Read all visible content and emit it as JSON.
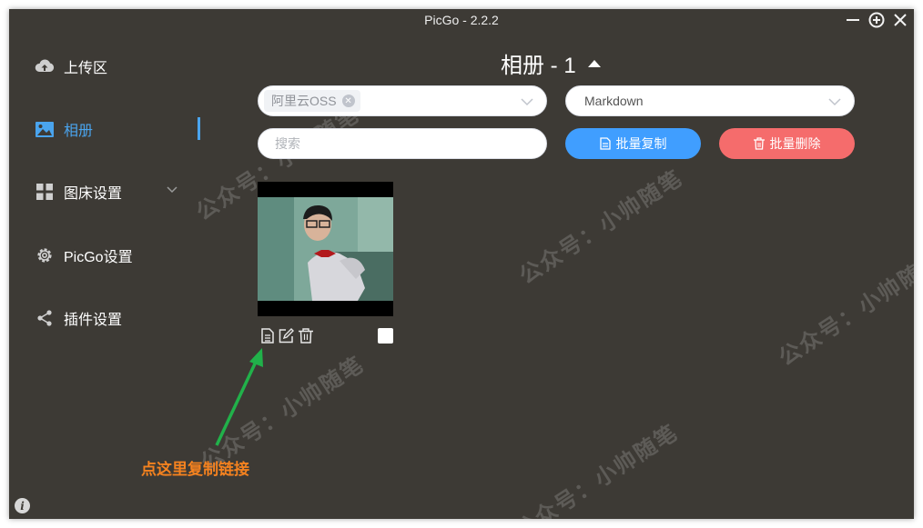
{
  "window": {
    "title": "PicGo - 2.2.2"
  },
  "window_controls": {
    "minimize": "minimize-icon",
    "maximize": "plus-circle-icon",
    "close": "close-icon"
  },
  "sidebar": {
    "items": [
      {
        "label": "上传区",
        "icon": "cloud-upload-icon",
        "active": false
      },
      {
        "label": "相册",
        "icon": "picture-icon",
        "active": true
      },
      {
        "label": "图床设置",
        "icon": "grid-icon",
        "active": false,
        "has_dropdown": true
      },
      {
        "label": "PicGo设置",
        "icon": "gear-icon",
        "active": false
      },
      {
        "label": "插件设置",
        "icon": "share-icon",
        "active": false
      }
    ]
  },
  "gallery": {
    "title": "相册 - 1",
    "bed_select": {
      "tag": "阿里云OSS"
    },
    "format_select": {
      "value": "Markdown"
    },
    "search": {
      "placeholder": "搜索",
      "value": ""
    },
    "copy_button": "批量复制",
    "delete_button": "批量删除",
    "items": [
      {
        "actions": [
          "copy-link-icon",
          "edit-icon",
          "delete-icon"
        ],
        "checked": false
      }
    ]
  },
  "annotation": {
    "text": "点这里复制链接"
  },
  "watermark": {
    "text": "公众号：小帅随笔"
  },
  "colors": {
    "background": "#3d3a35",
    "accent": "#409eff",
    "danger": "#f56c6c",
    "active_nav": "#4aa4ee",
    "annotation": "#f5821f",
    "arrow": "#21b14a"
  }
}
